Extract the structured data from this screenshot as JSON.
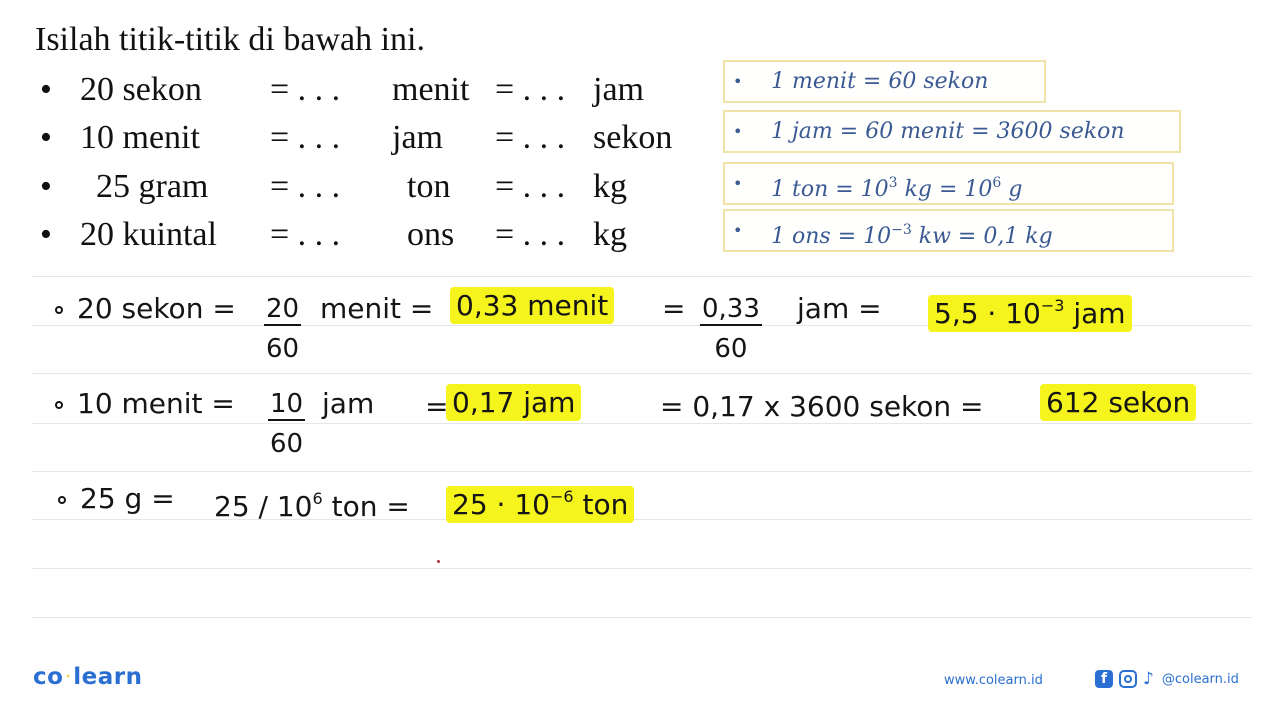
{
  "question": {
    "title": "Isilah titik-titik di bawah ini.",
    "bullet": "•",
    "rows": [
      {
        "a": "20 sekon",
        "eq1": "= . . .",
        "b": "menit",
        "eq2": "= . . .",
        "c": "jam"
      },
      {
        "a": "10 menit",
        "eq1": "= . . .",
        "b": "jam",
        "eq2": "= . . .",
        "c": "sekon"
      },
      {
        "a": "25 gram",
        "eq1": "= . . .",
        "b": "ton",
        "eq2": "= . . .",
        "c": "kg"
      },
      {
        "a": "20 kuintal",
        "eq1": "= . . .",
        "b": "ons",
        "eq2": "= . . .",
        "c": "kg"
      }
    ]
  },
  "formulas": {
    "bullet": "•",
    "f1": "1 menit = 60 sekon",
    "f2": "1 jam = 60 menit = 3600 sekon",
    "f3": {
      "pre": "1 ton = 10",
      "e1": "3",
      "mid": " kg = 10",
      "e2": "6",
      "post": " g"
    },
    "f4": {
      "pre": "1 ons = 10",
      "e1": "−3",
      "post": " kw = 0,1 kg"
    }
  },
  "solution": {
    "line1": {
      "lhs": "20 sekon =",
      "frac1_num": "20",
      "frac1_den": "60",
      "mid": "menit =",
      "ans1": "0,33 menit",
      "eq": "=",
      "frac2_num": "0,33",
      "frac2_den": "60",
      "mid2": "jam =",
      "ans2_base": "5,5 · 10",
      "ans2_exp": "−3",
      "ans2_unit": " jam"
    },
    "line2": {
      "lhs": "10 menit =",
      "frac_num": "10",
      "frac_den": "60",
      "mid": "jam",
      "eq": "=",
      "ans1": "0,17 jam",
      "calc": "= 0,17 x 3600 sekon =",
      "ans2": "612 sekon"
    },
    "line3": {
      "lhs": "25 g =",
      "mid_base": "25 / 10",
      "mid_exp": "6",
      "mid_unit": " ton =",
      "ans_base": "25 · 10",
      "ans_exp": "−6",
      "ans_unit": " ton"
    }
  },
  "footer": {
    "logo_left": "co",
    "logo_dot": "·",
    "logo_right": "learn",
    "website": "www.colearn.id",
    "facebook_glyph": "f",
    "tiktok_glyph": "♪",
    "handle": "@colearn.id"
  },
  "colors": {
    "highlight": "#f6f41d",
    "formula_text": "#3b5a93",
    "formula_border": "#efe3a8",
    "brand": "#2a6fd1"
  }
}
